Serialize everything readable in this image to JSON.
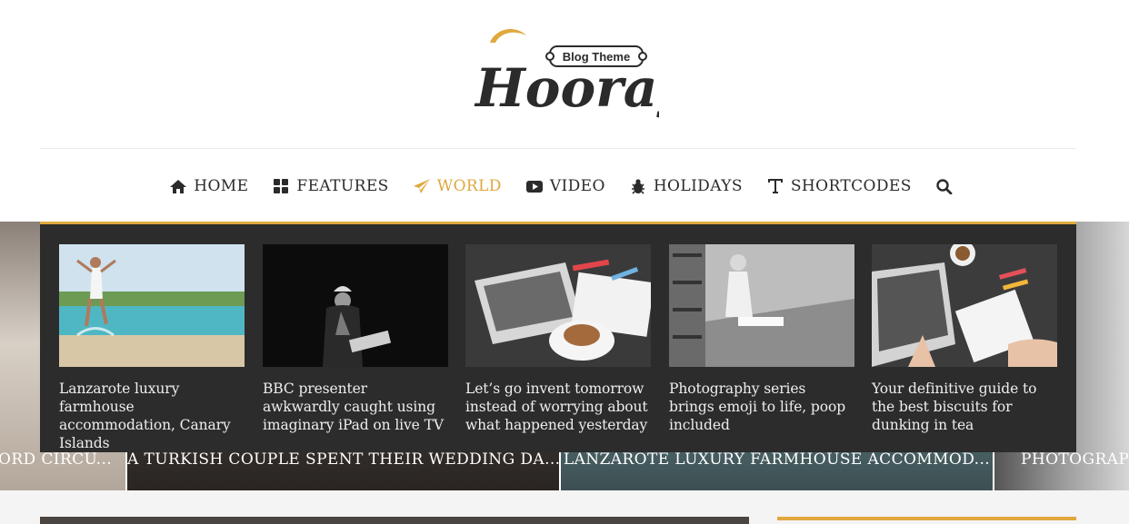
{
  "logo": {
    "badge_text": "Blog Theme",
    "wordmark": "Hooray"
  },
  "nav": {
    "items": [
      {
        "label": "HOME",
        "icon": "home-icon"
      },
      {
        "label": "FEATURES",
        "icon": "grid-icon"
      },
      {
        "label": "WORLD",
        "icon": "paper-plane-icon",
        "active": true
      },
      {
        "label": "VIDEO",
        "icon": "play-icon"
      },
      {
        "label": "HOLIDAYS",
        "icon": "bug-icon"
      },
      {
        "label": "SHORTCODES",
        "icon": "text-icon"
      }
    ],
    "search_icon": "search-icon",
    "accent": "#e0a83e"
  },
  "mega_menu": {
    "posts": [
      {
        "title": "Lanzarote luxury farmhouse accommodation, Canary Islands"
      },
      {
        "title": "BBC presenter awkwardly caught using imaginary iPad on live TV"
      },
      {
        "title": "Let’s go invent tomorrow instead of worrying about what happened yesterday"
      },
      {
        "title": "Photography series brings emoji to life, poop included"
      },
      {
        "title": "Your definitive guide to the best biscuits for dunking in tea"
      }
    ]
  },
  "slider": {
    "slides": [
      {
        "caption": "ORD CIRCU..."
      },
      {
        "caption": "A TURKISH COUPLE SPENT THEIR WEDDING DA..."
      },
      {
        "caption": "LANZAROTE LUXURY FARMHOUSE ACCOMMOD..."
      },
      {
        "caption": "PHOTOGRAPH"
      }
    ]
  }
}
